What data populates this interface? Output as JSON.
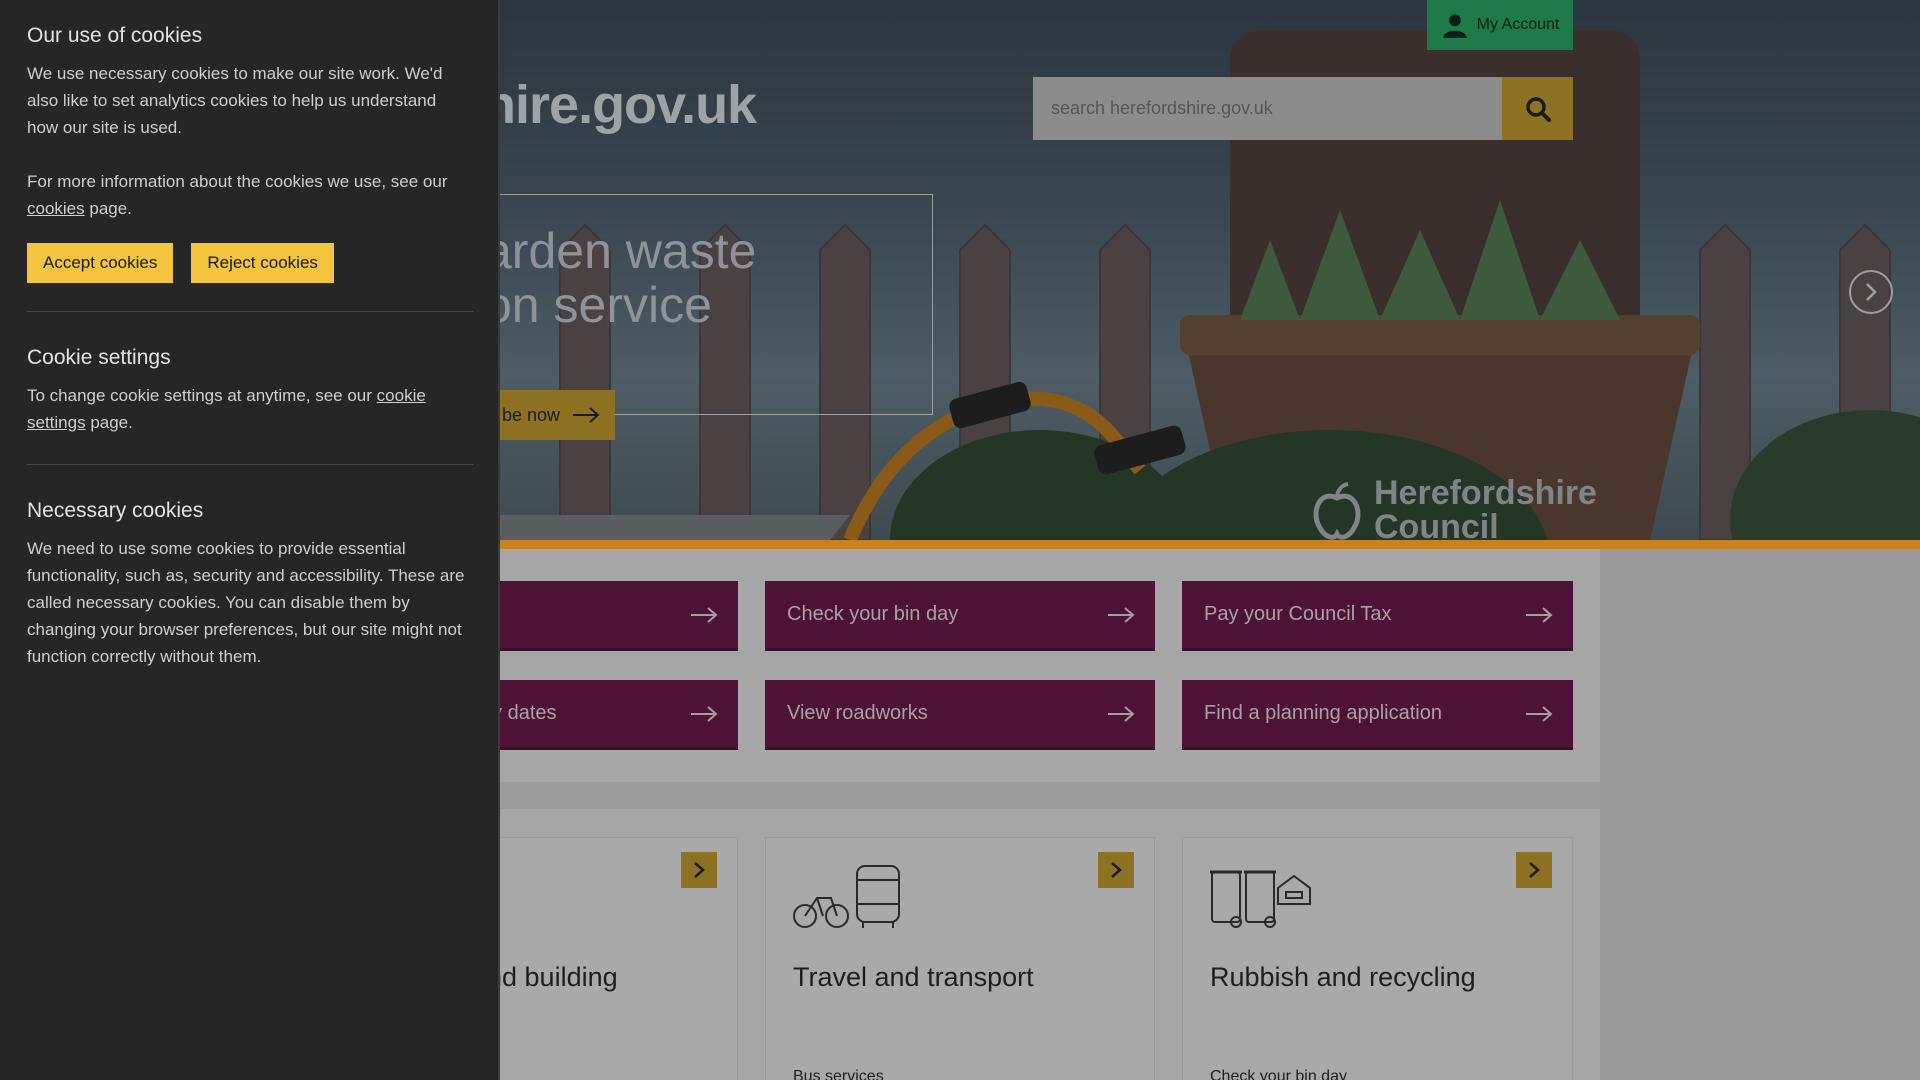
{
  "header": {
    "account_label": "My Account",
    "logo_text": "rdshire.gov.uk",
    "search_placeholder": "search herefordshire.gov.uk"
  },
  "hero": {
    "title": "arden waste\n on service",
    "cta_label": "be now",
    "council_logo_line1": "Herefordshire",
    "council_logo_line2": "Council"
  },
  "quick_links": [
    {
      "label": ""
    },
    {
      "label": "Check your bin day"
    },
    {
      "label": "Pay your Council Tax"
    },
    {
      "label": "d holiday dates"
    },
    {
      "label": "View roadworks"
    },
    {
      "label": "Find a planning application"
    }
  ],
  "topics": [
    {
      "title": "nd building",
      "sub": "",
      "icon": "house-icon"
    },
    {
      "title": "Travel and transport",
      "sub": "Bus services",
      "icon": "bike-bus-icon"
    },
    {
      "title": "Rubbish and recycling",
      "sub": "Check your bin day",
      "icon": "bins-icon"
    }
  ],
  "cookies": {
    "heading": "Our use of cookies",
    "intro": "We use necessary cookies to make our site work. We'd also like to set analytics cookies to help us understand how our site is used.",
    "more_info_prefix": "For more information about the cookies we use, see our ",
    "more_info_link": "cookies",
    "more_info_suffix": " page.",
    "accept_label": "Accept cookies",
    "reject_label": "Reject cookies",
    "settings_heading": "Cookie settings",
    "settings_prefix": "To change cookie settings at anytime, see our ",
    "settings_link": "cookie settings",
    "settings_suffix": " page.",
    "necessary_heading": "Necessary cookies",
    "necessary_text": "We need to use some cookies to provide essential functionality, such as, security and accessibility. These are called necessary cookies. You can disable them by changing your browser preferences, but our site might not function correctly without them."
  },
  "colors": {
    "cookie_bg": "#262626",
    "button_yellow": "#f4c43f",
    "quicklink_bg": "#4d1236",
    "account_green": "#1f7a4a"
  }
}
